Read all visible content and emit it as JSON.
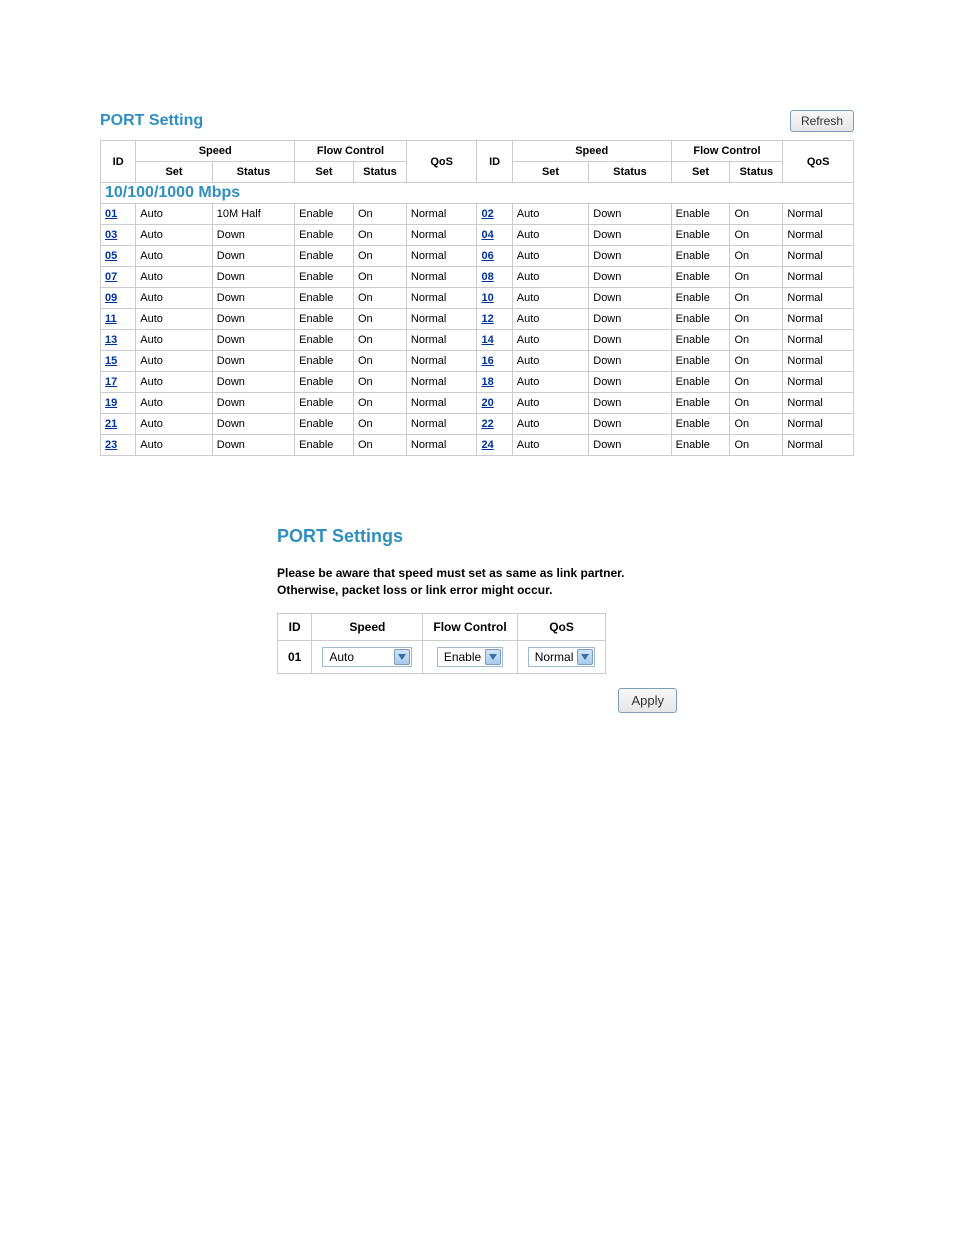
{
  "header": {
    "title": "PORT Setting",
    "refresh_label": "Refresh"
  },
  "port_table": {
    "headers": {
      "id": "ID",
      "speed": "Speed",
      "speed_set": "Set",
      "speed_status": "Status",
      "flow_control": "Flow Control",
      "fc_set": "Set",
      "fc_status": "Status",
      "qos": "QoS"
    },
    "section_label": "10/100/1000 Mbps",
    "rows": [
      {
        "left": {
          "id": "01",
          "speed_set": "Auto",
          "speed_status": "10M Half",
          "fc_set": "Enable",
          "fc_status": "On",
          "qos": "Normal"
        },
        "right": {
          "id": "02",
          "speed_set": "Auto",
          "speed_status": "Down",
          "fc_set": "Enable",
          "fc_status": "On",
          "qos": "Normal"
        }
      },
      {
        "left": {
          "id": "03",
          "speed_set": "Auto",
          "speed_status": "Down",
          "fc_set": "Enable",
          "fc_status": "On",
          "qos": "Normal"
        },
        "right": {
          "id": "04",
          "speed_set": "Auto",
          "speed_status": "Down",
          "fc_set": "Enable",
          "fc_status": "On",
          "qos": "Normal"
        }
      },
      {
        "left": {
          "id": "05",
          "speed_set": "Auto",
          "speed_status": "Down",
          "fc_set": "Enable",
          "fc_status": "On",
          "qos": "Normal"
        },
        "right": {
          "id": "06",
          "speed_set": "Auto",
          "speed_status": "Down",
          "fc_set": "Enable",
          "fc_status": "On",
          "qos": "Normal"
        }
      },
      {
        "left": {
          "id": "07",
          "speed_set": "Auto",
          "speed_status": "Down",
          "fc_set": "Enable",
          "fc_status": "On",
          "qos": "Normal"
        },
        "right": {
          "id": "08",
          "speed_set": "Auto",
          "speed_status": "Down",
          "fc_set": "Enable",
          "fc_status": "On",
          "qos": "Normal"
        }
      },
      {
        "left": {
          "id": "09",
          "speed_set": "Auto",
          "speed_status": "Down",
          "fc_set": "Enable",
          "fc_status": "On",
          "qos": "Normal"
        },
        "right": {
          "id": "10",
          "speed_set": "Auto",
          "speed_status": "Down",
          "fc_set": "Enable",
          "fc_status": "On",
          "qos": "Normal"
        }
      },
      {
        "left": {
          "id": "11",
          "speed_set": "Auto",
          "speed_status": "Down",
          "fc_set": "Enable",
          "fc_status": "On",
          "qos": "Normal"
        },
        "right": {
          "id": "12",
          "speed_set": "Auto",
          "speed_status": "Down",
          "fc_set": "Enable",
          "fc_status": "On",
          "qos": "Normal"
        }
      },
      {
        "left": {
          "id": "13",
          "speed_set": "Auto",
          "speed_status": "Down",
          "fc_set": "Enable",
          "fc_status": "On",
          "qos": "Normal"
        },
        "right": {
          "id": "14",
          "speed_set": "Auto",
          "speed_status": "Down",
          "fc_set": "Enable",
          "fc_status": "On",
          "qos": "Normal"
        }
      },
      {
        "left": {
          "id": "15",
          "speed_set": "Auto",
          "speed_status": "Down",
          "fc_set": "Enable",
          "fc_status": "On",
          "qos": "Normal"
        },
        "right": {
          "id": "16",
          "speed_set": "Auto",
          "speed_status": "Down",
          "fc_set": "Enable",
          "fc_status": "On",
          "qos": "Normal"
        }
      },
      {
        "left": {
          "id": "17",
          "speed_set": "Auto",
          "speed_status": "Down",
          "fc_set": "Enable",
          "fc_status": "On",
          "qos": "Normal"
        },
        "right": {
          "id": "18",
          "speed_set": "Auto",
          "speed_status": "Down",
          "fc_set": "Enable",
          "fc_status": "On",
          "qos": "Normal"
        }
      },
      {
        "left": {
          "id": "19",
          "speed_set": "Auto",
          "speed_status": "Down",
          "fc_set": "Enable",
          "fc_status": "On",
          "qos": "Normal"
        },
        "right": {
          "id": "20",
          "speed_set": "Auto",
          "speed_status": "Down",
          "fc_set": "Enable",
          "fc_status": "On",
          "qos": "Normal"
        }
      },
      {
        "left": {
          "id": "21",
          "speed_set": "Auto",
          "speed_status": "Down",
          "fc_set": "Enable",
          "fc_status": "On",
          "qos": "Normal"
        },
        "right": {
          "id": "22",
          "speed_set": "Auto",
          "speed_status": "Down",
          "fc_set": "Enable",
          "fc_status": "On",
          "qos": "Normal"
        }
      },
      {
        "left": {
          "id": "23",
          "speed_set": "Auto",
          "speed_status": "Down",
          "fc_set": "Enable",
          "fc_status": "On",
          "qos": "Normal"
        },
        "right": {
          "id": "24",
          "speed_set": "Auto",
          "speed_status": "Down",
          "fc_set": "Enable",
          "fc_status": "On",
          "qos": "Normal"
        }
      }
    ]
  },
  "settings": {
    "title": "PORT Settings",
    "note_line1": "Please be aware that speed must set as same as link partner.",
    "note_line2": "Otherwise, packet loss or link error might occur.",
    "headers": {
      "id": "ID",
      "speed": "Speed",
      "flow_control": "Flow Control",
      "qos": "QoS"
    },
    "id_value": "01",
    "speed_value": "Auto",
    "fc_value": "Enable",
    "qos_value": "Normal",
    "apply_label": "Apply"
  }
}
